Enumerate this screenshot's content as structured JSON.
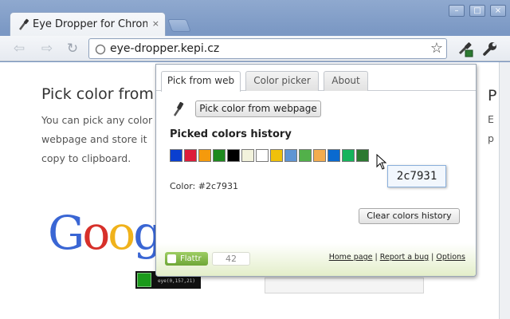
{
  "window": {
    "minimize_glyph": "–",
    "maximize_glyph": "□",
    "close_glyph": "×"
  },
  "tab": {
    "title": "Eye Dropper for Chrome",
    "close_glyph": "×"
  },
  "toolbar": {
    "back_glyph": "⇦",
    "forward_glyph": "⇨",
    "reload_glyph": "↻",
    "url": "eye-dropper.kepi.cz",
    "star_glyph": "☆"
  },
  "page": {
    "heading": "Pick color from",
    "para_lines": [
      "You can pick any color",
      "webpage and store it",
      "copy to clipboard."
    ],
    "google_letters": [
      {
        "ch": "G",
        "color": "#3a66d4"
      },
      {
        "ch": "o",
        "color": "#d7302a"
      },
      {
        "ch": "o",
        "color": "#f0b21b"
      },
      {
        "ch": "g",
        "color": "#3a66d4"
      }
    ],
    "magnifier_text": "eye(0,157,21)",
    "right_heading": "P",
    "right_lines": [
      "E",
      "p"
    ]
  },
  "popup": {
    "tabs": [
      {
        "label": "Pick from web",
        "active": true
      },
      {
        "label": "Color picker",
        "active": false
      },
      {
        "label": "About",
        "active": false
      }
    ],
    "pick_button": "Pick color from webpage",
    "history_heading": "Picked colors history",
    "swatches": [
      "#0a3fd0",
      "#dd1c3a",
      "#f59a0c",
      "#1e8a1e",
      "#000000",
      "#f2f2dc",
      "#ffffff",
      "#f0c10a",
      "#5f95d4",
      "#52b04a",
      "#f3ac4e",
      "#0a6ad0",
      "#15b45c",
      "#2c7931"
    ],
    "color_label": "Color: #2c7931",
    "tooltip": "2c7931",
    "clear_button": "Clear colors history",
    "flattr_label": "Flattr",
    "flattr_count": "42",
    "links": [
      "Home page",
      "Report a bug",
      "Options"
    ]
  }
}
